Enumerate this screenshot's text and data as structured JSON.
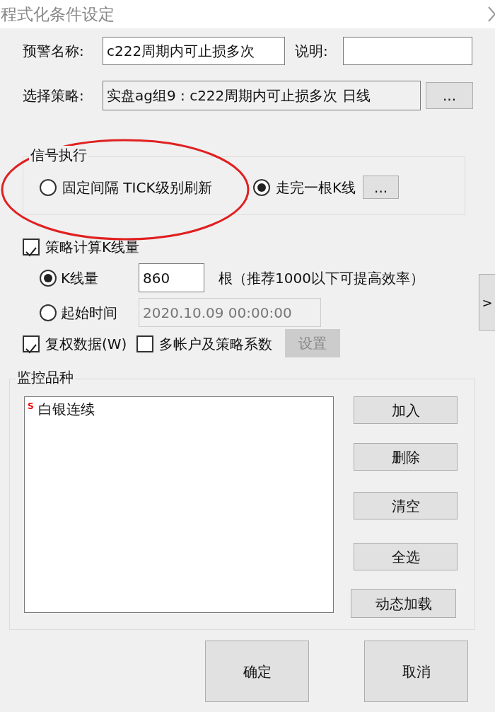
{
  "window": {
    "title": "程式化条件设定"
  },
  "alert_name": {
    "label": "预警名称:",
    "value": "c222周期内可止损多次"
  },
  "description": {
    "label": "说明:"
  },
  "strategy": {
    "label": "选择策略:",
    "value": "实盘ag组9 : c222周期内可止损多次 日线",
    "button": "..."
  },
  "signal_group": {
    "title": "信号执行",
    "options": [
      {
        "label": "固定间隔 TICK级别刷新",
        "selected": false
      },
      {
        "label": "走完一根K线",
        "selected": true
      }
    ],
    "button": "..."
  },
  "kline_calc": {
    "label": "策略计算K线量",
    "checked": true,
    "options": [
      {
        "kind": "count",
        "label": "K线量",
        "selected": true,
        "value": "860",
        "note": "根（推荐1000以下可提高效率）"
      },
      {
        "kind": "time",
        "label": "起始时间",
        "selected": false,
        "value": "2020.10.09 00:00:00"
      }
    ]
  },
  "expand_button": ">",
  "checkboxes": [
    {
      "label": "复权数据(W)",
      "checked": true
    },
    {
      "label": "多帐户及策略系数",
      "checked": false
    }
  ],
  "settings_button": {
    "label": "设置",
    "disabled": true
  },
  "monitor": {
    "title": "监控品种",
    "items": [
      {
        "badge": "S",
        "label": "白银连续"
      }
    ],
    "buttons": [
      "加入",
      "删除",
      "清空",
      "全选",
      "动态加载"
    ]
  },
  "footer_buttons": [
    "确定",
    "取消"
  ]
}
